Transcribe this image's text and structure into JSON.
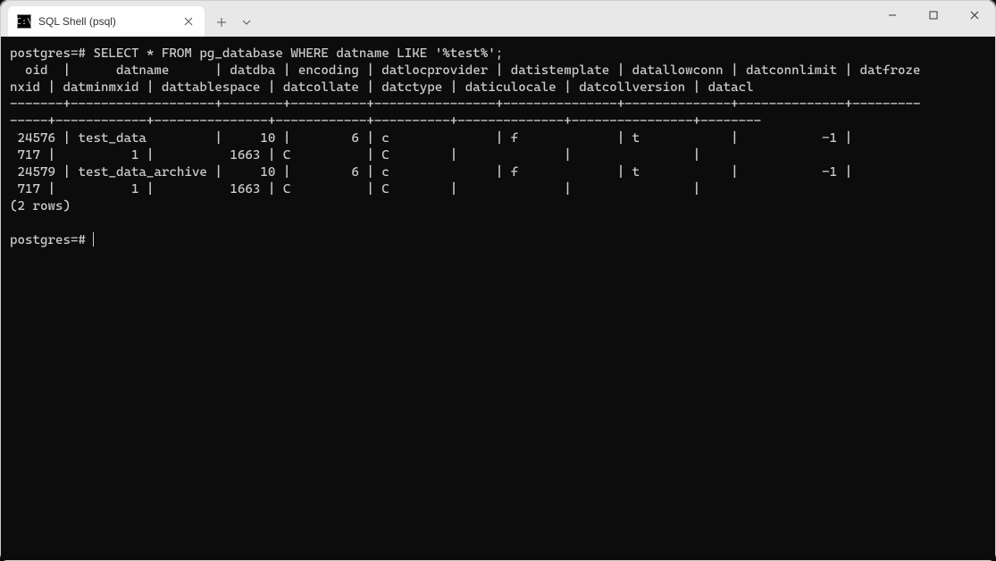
{
  "window": {
    "tab_title": "SQL Shell (psql)",
    "tab_icon_text": "C:\\"
  },
  "terminal": {
    "prompt": "postgres=#",
    "command": "SELECT * FROM pg_database WHERE datname LIKE '%test%';",
    "headers_line1": "  oid  |      datname      | datdba | encoding | datlocprovider | datistemplate | datallowconn | datconnlimit | datfroze",
    "headers_line2": "nxid | datminmxid | dattablespace | datcollate | datctype | daticulocale | datcollversion | datacl",
    "sep_line1": "-------+-------------------+--------+----------+----------------+---------------+--------------+--------------+---------",
    "sep_line2": "-----+------------+---------------+------------+----------+--------------+----------------+--------",
    "row1_line1": " 24576 | test_data         |     10 |        6 | c              | f             | t            |           -1 |         ",
    "row1_line2": " 717 |          1 |          1663 | C          | C        |              |                |",
    "row2_line1": " 24579 | test_data_archive |     10 |        6 | c              | f             | t            |           -1 |         ",
    "row2_line2": " 717 |          1 |          1663 | C          | C        |              |                |",
    "row_count": "(2 rows)",
    "blank": "",
    "prompt_after": "postgres=# "
  }
}
